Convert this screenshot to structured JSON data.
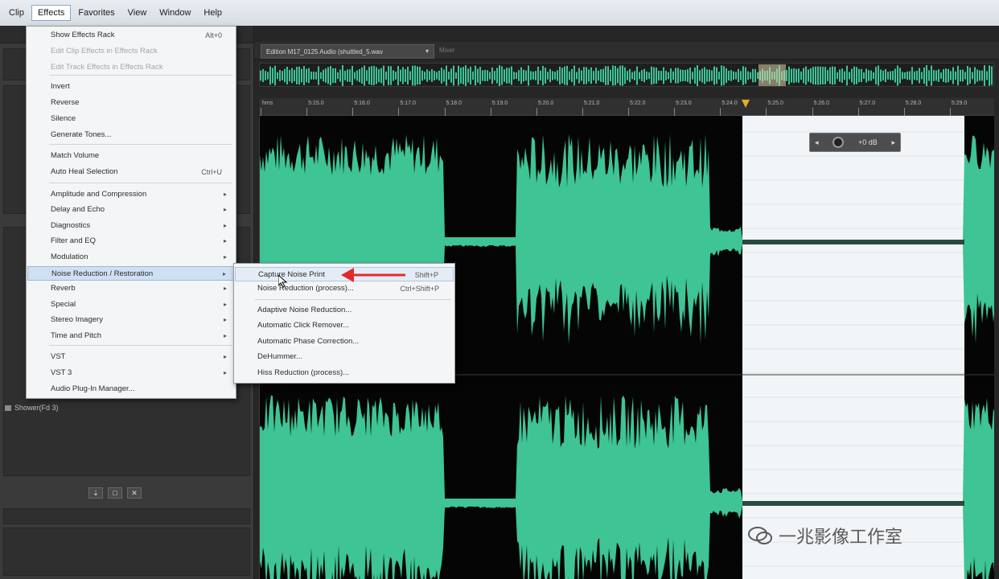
{
  "menubar": {
    "items": [
      "Clip",
      "Effects",
      "Favorites",
      "View",
      "Window",
      "Help"
    ],
    "active_index": 1
  },
  "left_panel": {
    "file_label": "Shower(Fd 3)"
  },
  "editor": {
    "tab_label": "Edition M17_0125 Audio (shuttled_5.wav",
    "tab2_label": "Mixer",
    "ruler_ticks": [
      "hms",
      "5:15.0",
      "5:16.0",
      "5:17.0",
      "5:18.0",
      "5:19.0",
      "5:20.0",
      "5:21.0",
      "5:22.0",
      "5:23.0",
      "5:24.0",
      "5:25.0",
      "5:26.0",
      "5:27.0",
      "5:28.0",
      "5:29.0"
    ],
    "hud_value": "+0 dB",
    "wave_color": "#3ec495",
    "selection_color": "#f2f5f7"
  },
  "effects_menu": {
    "items": [
      {
        "label": "Show Effects Rack",
        "shortcut": "Alt+0",
        "disabled": false
      },
      {
        "label": "Edit Clip Effects in Effects Rack",
        "shortcut": "",
        "disabled": true
      },
      {
        "label": "Edit Track Effects in Effects Rack",
        "shortcut": "",
        "disabled": true
      },
      {
        "label": "Invert",
        "shortcut": "",
        "disabled": false
      },
      {
        "label": "Reverse",
        "shortcut": "",
        "disabled": false
      },
      {
        "label": "Silence",
        "shortcut": "",
        "disabled": false
      },
      {
        "label": "Generate Tones...",
        "shortcut": "",
        "disabled": false
      },
      {
        "label": "Match Volume",
        "shortcut": "",
        "disabled": false
      },
      {
        "label": "Auto Heal Selection",
        "shortcut": "Ctrl+U",
        "disabled": false
      },
      {
        "label": "Amplitude and Compression",
        "shortcut": "",
        "disabled": false
      },
      {
        "label": "Delay and Echo",
        "shortcut": "",
        "disabled": false
      },
      {
        "label": "Diagnostics",
        "shortcut": "",
        "disabled": false
      },
      {
        "label": "Filter and EQ",
        "shortcut": "",
        "disabled": false
      },
      {
        "label": "Modulation",
        "shortcut": "",
        "disabled": false
      },
      {
        "label": "Noise Reduction / Restoration",
        "shortcut": "",
        "disabled": false
      },
      {
        "label": "Reverb",
        "shortcut": "",
        "disabled": false
      },
      {
        "label": "Special",
        "shortcut": "",
        "disabled": false
      },
      {
        "label": "Stereo Imagery",
        "shortcut": "",
        "disabled": false
      },
      {
        "label": "Time and Pitch",
        "shortcut": "",
        "disabled": false
      },
      {
        "label": "VST",
        "shortcut": "",
        "disabled": false
      },
      {
        "label": "VST 3",
        "shortcut": "",
        "disabled": false
      },
      {
        "label": "Audio Plug-In Manager...",
        "shortcut": "",
        "disabled": false
      }
    ]
  },
  "noise_submenu": {
    "items": [
      {
        "label": "Capture Noise Print",
        "shortcut": "Shift+P"
      },
      {
        "label": "Noise Reduction (process)...",
        "shortcut": "Ctrl+Shift+P"
      },
      {
        "label": "Adaptive Noise Reduction...",
        "shortcut": ""
      },
      {
        "label": "Automatic Click Remover...",
        "shortcut": ""
      },
      {
        "label": "Automatic Phase Correction...",
        "shortcut": ""
      },
      {
        "label": "DeHummer...",
        "shortcut": ""
      },
      {
        "label": "Hiss Reduction (process)...",
        "shortcut": ""
      }
    ]
  },
  "watermark": {
    "text": "一兆影像工作室"
  }
}
